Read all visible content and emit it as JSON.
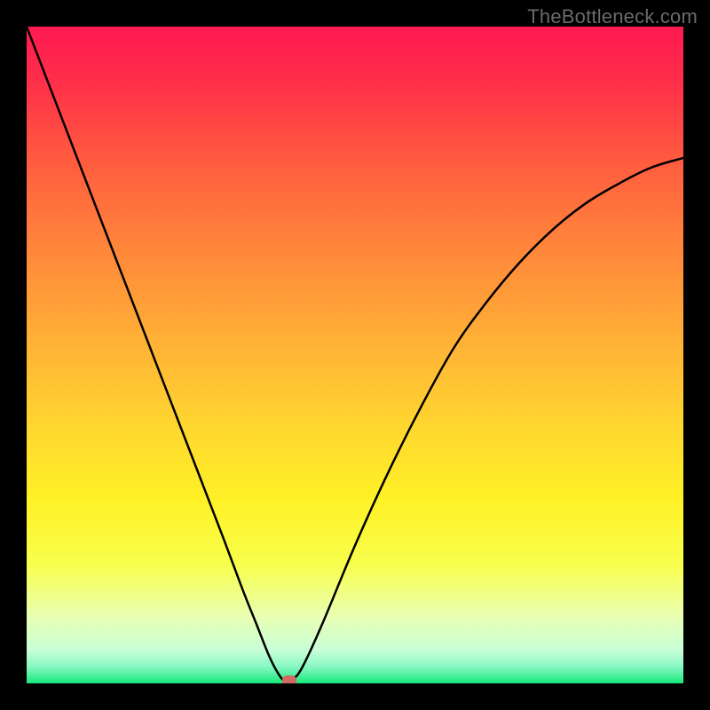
{
  "watermark": "TheBottleneck.com",
  "chart_data": {
    "type": "line",
    "title": "",
    "xlabel": "",
    "ylabel": "",
    "xlim": [
      0,
      100
    ],
    "ylim": [
      0,
      100
    ],
    "series": [
      {
        "name": "bottleneck-curve",
        "x": [
          0,
          5,
          10,
          15,
          20,
          25,
          30,
          33,
          35,
          37,
          38.5,
          39.5,
          40.5,
          42,
          45,
          50,
          55,
          60,
          65,
          70,
          75,
          80,
          85,
          90,
          95,
          100
        ],
        "y": [
          100,
          87,
          74,
          61,
          48,
          35,
          22,
          14,
          9,
          4,
          1.2,
          0.3,
          0.6,
          2.5,
          9,
          21,
          32,
          42,
          51,
          58,
          64,
          69,
          73,
          76,
          78.5,
          80
        ]
      }
    ],
    "marker": {
      "x": 40,
      "y": 0
    },
    "gradient_stops": [
      {
        "offset": 0.0,
        "color": "#ff1a51"
      },
      {
        "offset": 0.08,
        "color": "#ff2d4a"
      },
      {
        "offset": 0.2,
        "color": "#ff5a3f"
      },
      {
        "offset": 0.35,
        "color": "#ff8a3a"
      },
      {
        "offset": 0.5,
        "color": "#ffb735"
      },
      {
        "offset": 0.62,
        "color": "#ffd92f"
      },
      {
        "offset": 0.72,
        "color": "#fff126"
      },
      {
        "offset": 0.82,
        "color": "#f8ff4d"
      },
      {
        "offset": 0.9,
        "color": "#e8ffb5"
      },
      {
        "offset": 0.95,
        "color": "#c7ffd7"
      },
      {
        "offset": 0.975,
        "color": "#86f7c3"
      },
      {
        "offset": 1.0,
        "color": "#17e87a"
      }
    ]
  }
}
